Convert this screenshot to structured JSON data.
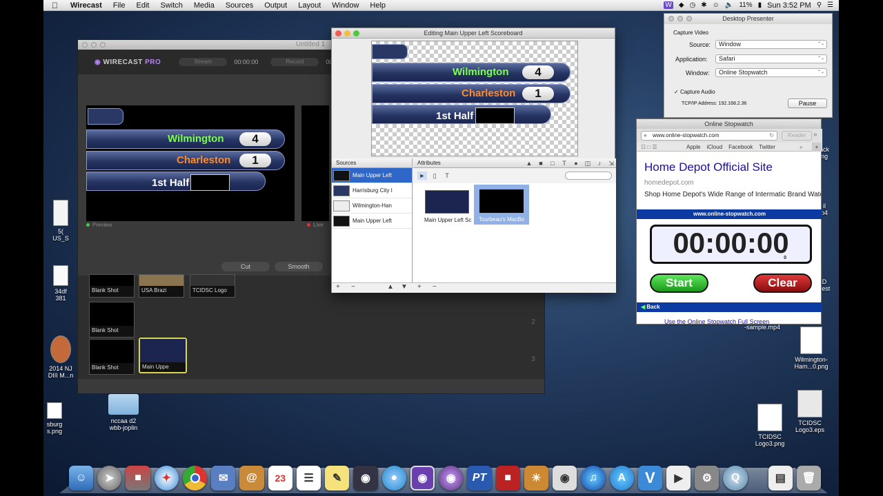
{
  "menubar": {
    "apple": "",
    "app_name": "Wirecast",
    "items": [
      "File",
      "Edit",
      "Switch",
      "Media",
      "Sources",
      "Output",
      "Layout",
      "Window",
      "Help"
    ],
    "battery": "11%",
    "clock": "Sun 3:52 PM"
  },
  "wirecast": {
    "window_title": "Untitled 1",
    "logo_main": "WIRECAST",
    "logo_sub": "PRO",
    "stream_label": "Stream",
    "stream_time": "00:00:00",
    "record_label": "Record",
    "record_time": "00:00:00",
    "preview_label": "Preview",
    "live_label": "Live",
    "transition_cut": "Cut",
    "transition_smooth": "Smooth",
    "shots": [
      {
        "label": "Blank Shot"
      },
      {
        "label": "USA Brazi"
      },
      {
        "label": "TCIDSC Logo"
      },
      {
        "label": "Blank Shot"
      },
      {
        "label": "Blank Shot"
      },
      {
        "label": "Main Uppe"
      }
    ],
    "row_numbers": [
      "2",
      "3"
    ]
  },
  "scoreboard": {
    "team1": "Wilmington",
    "score1": "4",
    "team2": "Charleston",
    "score2": "1",
    "period": "1st Half",
    "team1_color": "#7cff4a",
    "team2_color": "#ff8a2a"
  },
  "editor": {
    "title": "Editing Main Upper Left Scoreboard",
    "sources_header": "Sources",
    "attributes_header": "Attributes",
    "sources": [
      "Main Upper Left",
      "Harrisburg City I",
      "Wilmington-Han",
      "Main Upper Left"
    ],
    "layers": [
      "Main Upper Left Sc",
      "Tourbeau's MacBo"
    ]
  },
  "presenter": {
    "title": "Desktop Presenter",
    "section": "Capture Video",
    "source_label": "Source:",
    "source_value": "Window",
    "application_label": "Application:",
    "application_value": "Safari",
    "window_label": "Window:",
    "window_value": "Online Stopwatch",
    "capture_audio": "Capture Audio",
    "ip": "TCP/IP Address: 192.168.2.36",
    "pause": "Pause"
  },
  "safari": {
    "title": "Online Stopwatch",
    "url": "www.online-stopwatch.com",
    "reader": "Reader",
    "bookmarks": [
      "Apple",
      "iCloud",
      "Facebook",
      "Twitter"
    ],
    "ad_title": "Home Depot Official Site",
    "ad_domain": "homedepot.com",
    "ad_text": "Shop Home Depot's Wide Range of Intermatic Brand Wate",
    "banner": "www.online-stopwatch.com",
    "time": "00:00:00",
    "sub": "0",
    "start": "Start",
    "clear": "Clear",
    "back": "Back",
    "fullscreen": "Use the Online Stopwatch Full Screen"
  },
  "desktop": {
    "left_icons": [
      {
        "label": "5(\nUS_S"
      },
      {
        "label": "34df\n381"
      },
      {
        "label": "2014 NJ\nDIII M...n"
      },
      {
        "label": "sburg\ns.png"
      }
    ],
    "folder": "nccaa d2\nwbb-joplin",
    "right_icons": [
      {
        "label": "ack\nng"
      },
      {
        "label": "il\np4"
      },
      {
        "label": "D\ncest"
      },
      {
        "label": "-sample.mp4"
      },
      {
        "label": "Wilmington-\nHam...0.png"
      },
      {
        "label": "TCIDSC\nLogo3.png"
      },
      {
        "label": "TCIDSC\nLogo3.eps"
      }
    ],
    "calendar_day": "23"
  }
}
